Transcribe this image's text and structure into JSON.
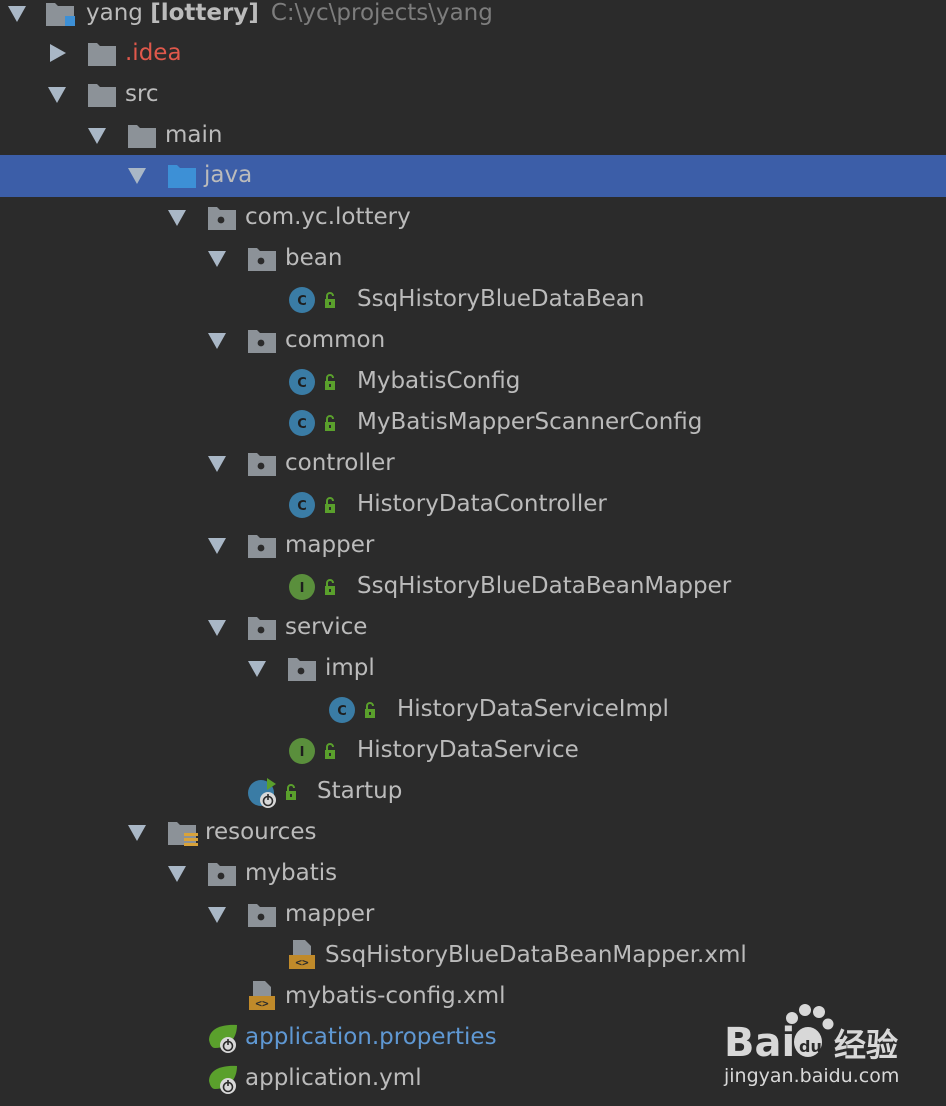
{
  "project": {
    "name": "yang",
    "module": "[lottery]",
    "path": "C:\\yc\\projects\\yang"
  },
  "nodes": {
    "idea": ".idea",
    "src": "src",
    "main": "main",
    "java": "java",
    "package": "com.yc.lottery",
    "bean": "bean",
    "bean_class": "SsqHistoryBlueDataBean",
    "common": "common",
    "mybatis_config": "MybatisConfig",
    "scanner_config": "MyBatisMapperScannerConfig",
    "controller": "controller",
    "controller_class": "HistoryDataController",
    "mapper": "mapper",
    "mapper_iface": "SsqHistoryBlueDataBeanMapper",
    "service": "service",
    "impl": "impl",
    "impl_class": "HistoryDataServiceImpl",
    "service_iface": "HistoryDataService",
    "startup": "Startup",
    "resources": "resources",
    "mybatis": "mybatis",
    "res_mapper": "mapper",
    "mapper_xml": "SsqHistoryBlueDataBeanMapper.xml",
    "mybatis_config_xml": "mybatis-config.xml",
    "app_properties": "application.properties",
    "app_yml": "application.yml"
  },
  "watermark": {
    "brand": "Bai",
    "brand2": "du",
    "cn": "经验",
    "url": "jingyan.baidu.com"
  },
  "colors": {
    "background": "#2b2b2b",
    "selection": "#3c5ea8",
    "text": "#bbbbbb",
    "excluded": "#e0584b",
    "modified": "#5f98d3",
    "class_icon": "#3a7ca5",
    "interface_icon": "#5a8f3c"
  }
}
